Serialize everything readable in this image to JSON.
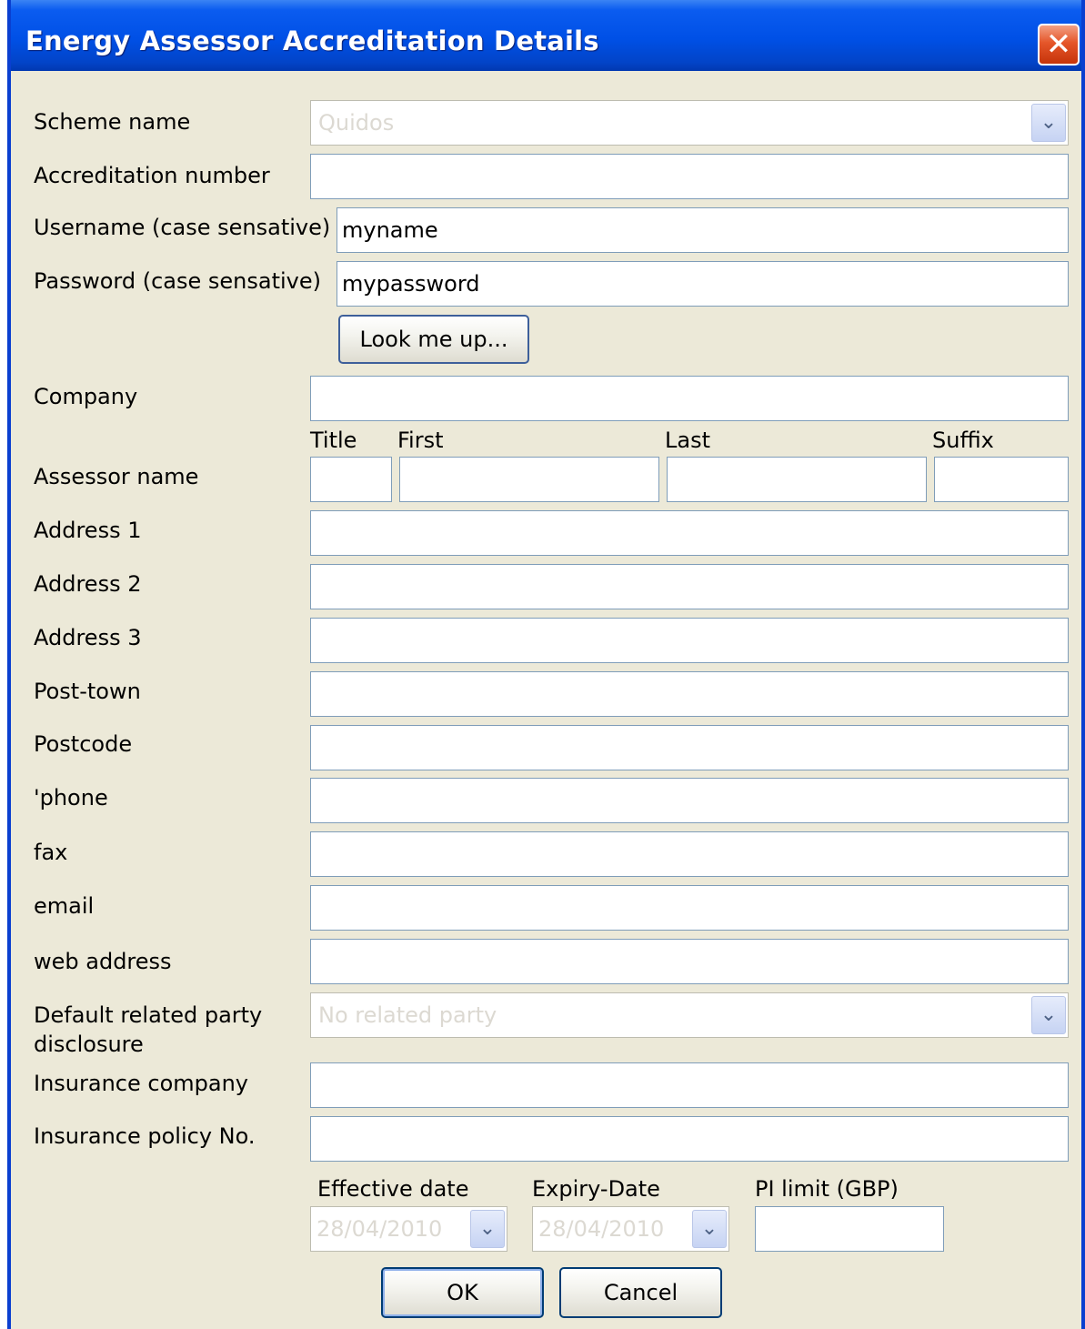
{
  "window": {
    "title": "Energy Assessor Accreditation Details"
  },
  "labels": {
    "scheme_name": "Scheme name",
    "accreditation_number": "Accreditation number",
    "username": "Username (case sensative)",
    "password": "Password (case sensative)",
    "company": "Company",
    "assessor_name": "Assessor name",
    "address1": "Address 1",
    "address2": "Address 2",
    "address3": "Address 3",
    "post_town": "Post-town",
    "postcode": "Postcode",
    "phone": "'phone",
    "fax": "fax",
    "email": "email",
    "web_address": "web address",
    "related_party": "Default related party disclosure",
    "insurance_company": "Insurance company",
    "insurance_policy": "Insurance policy No."
  },
  "name_columns": {
    "title": "Title",
    "first": "First",
    "last": "Last",
    "suffix": "Suffix"
  },
  "date_columns": {
    "effective": "Effective date",
    "expiry": "Expiry-Date",
    "pi_limit": "PI limit (GBP)"
  },
  "values": {
    "scheme_name": "Quidos",
    "username": "myname",
    "password": "mypassword",
    "related_party": "No related party",
    "effective_date": "28/04/2010",
    "expiry_date": "28/04/2010"
  },
  "buttons": {
    "look_me_up": "Look me up...",
    "ok": "OK",
    "cancel": "Cancel"
  },
  "icons": {
    "close": "close-icon",
    "dropdown": "chevron-down-icon"
  },
  "colors": {
    "titlebar": "#0050e6",
    "window_bg": "#ece9d8",
    "close_button": "#e5562a"
  }
}
